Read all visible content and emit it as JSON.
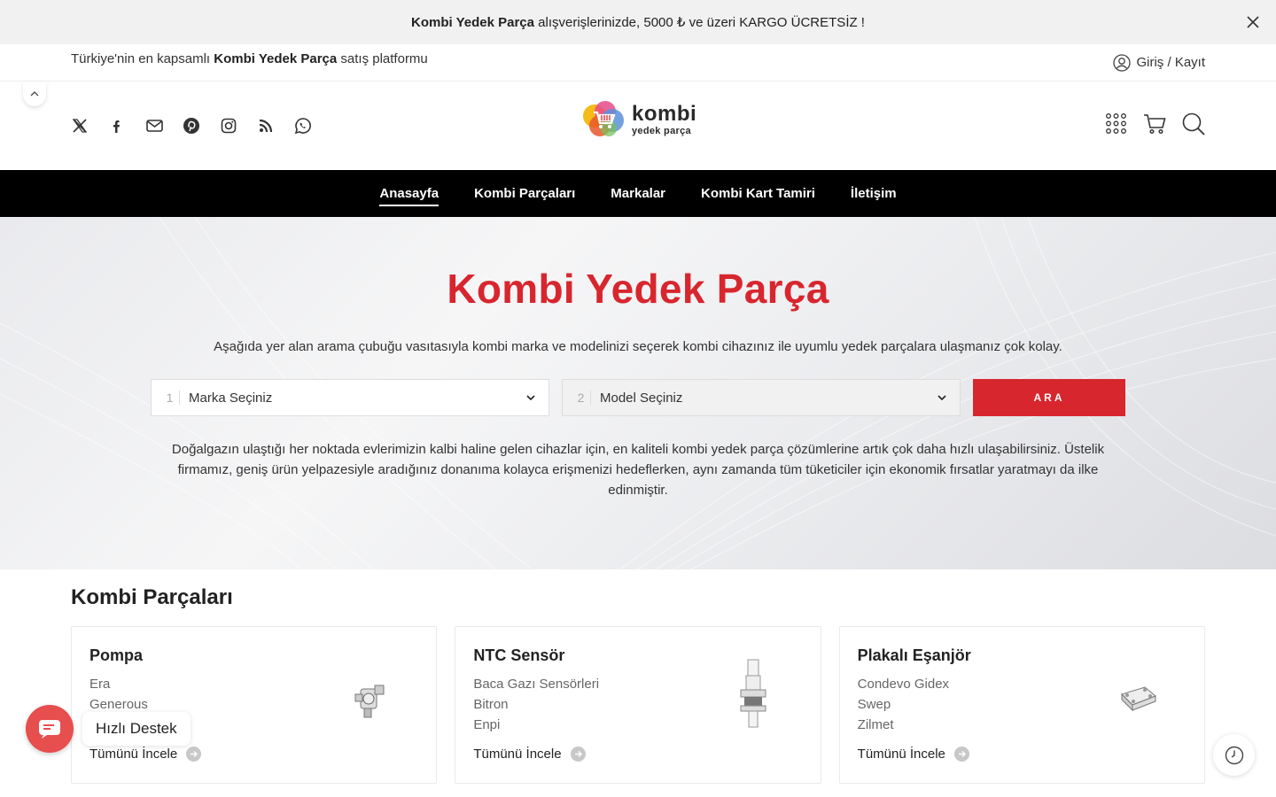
{
  "announcement": {
    "bold": "Kombi Yedek Parça",
    "text": " alışverişlerinizde, 5000 ₺ ve üzeri KARGO ÜCRETSİZ !"
  },
  "topbar": {
    "tagline_pre": "Türkiye'nin en kapsamlı ",
    "tagline_bold": "Kombi Yedek Parça",
    "tagline_post": " satış platformu",
    "login": "Giriş / Kayıt"
  },
  "logo": {
    "line1": "kombi",
    "line2": "yedek parça"
  },
  "nav": [
    "Anasayfa",
    "Kombi Parçaları",
    "Markalar",
    "Kombi Kart Tamiri",
    "İletişim"
  ],
  "hero": {
    "title": "Kombi Yedek Parça",
    "subtitle": "Aşağıda yer alan arama çubuğu vasıtasıyla kombi marka ve modelinizi seçerek kombi cihazınız ile uyumlu yedek parçalara ulaşmanız çok kolay.",
    "brand_select": {
      "num": "1",
      "label": "Marka Seçiniz"
    },
    "model_select": {
      "num": "2",
      "label": "Model Seçiniz"
    },
    "search_button": "ARA",
    "description": "Doğalgazın ulaştığı her noktada evlerimizin kalbi haline gelen cihazlar için, en kaliteli kombi yedek parça çözümlerine artık çok daha hızlı ulaşabilirsiniz. Üstelik firmamız, geniş ürün yelpazesiyle aradığınız donanıma kolayca erişmenizi hedeflerken, aynı zamanda tüm tüketiciler için ekonomik fırsatlar yaratmayı da ilke edinmiştir."
  },
  "parts": {
    "title": "Kombi Parçaları",
    "cards": [
      {
        "title": "Pompa",
        "items": [
          "Era",
          "Generous"
        ],
        "more": "Tümünü İncele"
      },
      {
        "title": "NTC Sensör",
        "items": [
          "Baca Gazı Sensörleri",
          "Bitron",
          "Enpi"
        ],
        "more": "Tümünü İncele"
      },
      {
        "title": "Plakalı Eşanjör",
        "items": [
          "Condevo Gidex",
          "Swep",
          "Zilmet"
        ],
        "more": "Tümünü İncele"
      }
    ]
  },
  "chat": {
    "label": "Hızlı Destek"
  },
  "colors": {
    "accent": "#d8262e",
    "nav_bg": "#000000",
    "chat": "#e74e4e"
  }
}
